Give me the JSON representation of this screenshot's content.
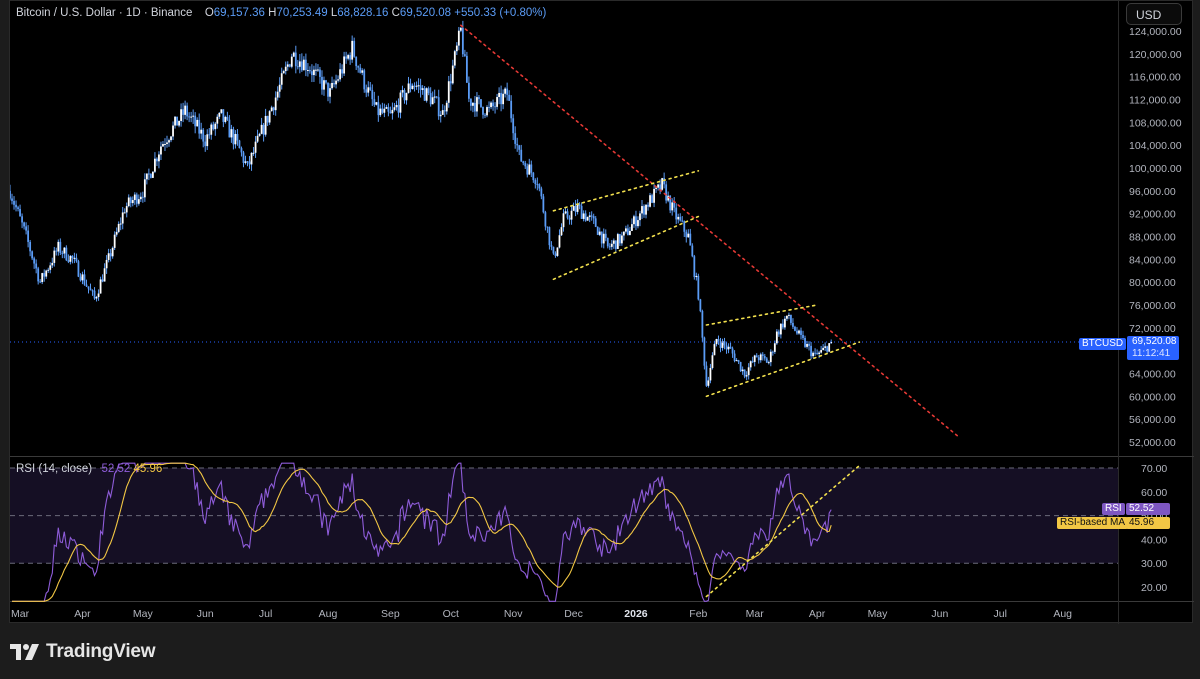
{
  "header": {
    "symbol": "Bitcoin / U.S. Dollar · 1D · Binance",
    "open_key": "O",
    "open": "69,157.36",
    "high_key": "H",
    "high": "70,253.49",
    "low_key": "L",
    "low": "68,828.16",
    "close_key": "C",
    "close": "69,520.08",
    "change": "+550.33 (+0.80%)"
  },
  "currency_button": "USD",
  "price_tag": {
    "symbol": "BTCUSD",
    "price": "69,520.08",
    "countdown": "11:12:41"
  },
  "rsi_legend": {
    "label": "RSI (14, close)",
    "rsi_value": "52.52",
    "ma_value": "45.96"
  },
  "rsi_tags": {
    "rsi_label": "RSI",
    "rsi_value": "52.52",
    "ma_label": "RSI-based MA",
    "ma_value": "45.96"
  },
  "branding": {
    "name": "TradingView"
  },
  "colors": {
    "candle": "#5b9cf6",
    "red_trend": "#e53935",
    "yellow": "#f2e04d",
    "rsi": "#8e5cd9",
    "rsi_ma": "#f2c744",
    "current_price": "#2962ff"
  },
  "chart_data": [
    {
      "type": "candlestick",
      "title": "Bitcoin / U.S. Dollar · 1D · Binance",
      "ylim": [
        50000,
        126000
      ],
      "y_ticks": [
        "124,000.00",
        "120,000.00",
        "116,000.00",
        "112,000.00",
        "108,000.00",
        "104,000.00",
        "100,000.00",
        "96,000.00",
        "92,000.00",
        "88,000.00",
        "84,000.00",
        "80,000.00",
        "76,000.00",
        "72,000.00",
        "68,000.00",
        "64,000.00",
        "60,000.00",
        "56,000.00",
        "52,000.00"
      ],
      "x_ticks": [
        "Mar",
        "Apr",
        "May",
        "Jun",
        "Jul",
        "Aug",
        "Sep",
        "Oct",
        "Nov",
        "Dec",
        "2026",
        "Feb",
        "Mar",
        "Apr",
        "May",
        "Jun",
        "Jul",
        "Aug"
      ],
      "x_range": [
        "2025-02-24",
        "2026-08-28"
      ],
      "current_price": 69520.08,
      "price_path": [
        [
          "2025-02-24",
          96000
        ],
        [
          "2025-03-04",
          88000
        ],
        [
          "2025-03-11",
          80000
        ],
        [
          "2025-03-20",
          86000
        ],
        [
          "2025-03-27",
          84000
        ],
        [
          "2025-04-07",
          77000
        ],
        [
          "2025-04-14",
          84000
        ],
        [
          "2025-04-22",
          93000
        ],
        [
          "2025-05-01",
          96000
        ],
        [
          "2025-05-10",
          104000
        ],
        [
          "2025-05-22",
          110000
        ],
        [
          "2025-06-01",
          105000
        ],
        [
          "2025-06-09",
          109000
        ],
        [
          "2025-06-17",
          104000
        ],
        [
          "2025-06-22",
          100000
        ],
        [
          "2025-07-01",
          108000
        ],
        [
          "2025-07-10",
          116000
        ],
        [
          "2025-07-14",
          120000
        ],
        [
          "2025-07-22",
          118000
        ],
        [
          "2025-08-02",
          113000
        ],
        [
          "2025-08-13",
          121000
        ],
        [
          "2025-08-19",
          115000
        ],
        [
          "2025-08-25",
          110000
        ],
        [
          "2025-09-01",
          109000
        ],
        [
          "2025-09-12",
          115000
        ],
        [
          "2025-09-22",
          112000
        ],
        [
          "2025-09-27",
          109500
        ],
        [
          "2025-10-06",
          124000
        ],
        [
          "2025-10-10",
          112000
        ],
        [
          "2025-10-20",
          110000
        ],
        [
          "2025-10-29",
          113000
        ],
        [
          "2025-11-04",
          102000
        ],
        [
          "2025-11-13",
          98000
        ],
        [
          "2025-11-21",
          84000
        ],
        [
          "2025-11-26",
          91000
        ],
        [
          "2025-12-03",
          93000
        ],
        [
          "2025-12-12",
          90000
        ],
        [
          "2025-12-18",
          86000
        ],
        [
          "2025-12-26",
          88000
        ],
        [
          "2026-01-05",
          93000
        ],
        [
          "2026-01-14",
          97000
        ],
        [
          "2026-01-20",
          92000
        ],
        [
          "2026-01-27",
          88000
        ],
        [
          "2026-02-01",
          78000
        ],
        [
          "2026-02-05",
          62000
        ],
        [
          "2026-02-10",
          70000
        ],
        [
          "2026-02-17",
          68000
        ],
        [
          "2026-02-24",
          64000
        ],
        [
          "2026-03-02",
          67000
        ],
        [
          "2026-03-08",
          66000
        ],
        [
          "2026-03-12",
          71000
        ],
        [
          "2026-03-17",
          74000
        ],
        [
          "2026-03-24",
          70000
        ],
        [
          "2026-03-31",
          67000
        ],
        [
          "2026-04-04",
          68000
        ],
        [
          "2026-04-08",
          69520
        ]
      ],
      "trendlines": [
        {
          "name": "descending resistance",
          "color": "#e53935",
          "points": [
            [
              "2025-10-06",
              125000
            ],
            [
              "2026-06-10",
              53000
            ]
          ]
        },
        {
          "name": "channel 1 upper",
          "color": "#f2e04d",
          "points": [
            [
              "2025-11-21",
              92500
            ],
            [
              "2026-02-01",
              99500
            ]
          ]
        },
        {
          "name": "channel 1 lower",
          "color": "#f2e04d",
          "points": [
            [
              "2025-11-21",
              80500
            ],
            [
              "2026-02-01",
              91500
            ]
          ]
        },
        {
          "name": "channel 2 upper",
          "color": "#f2e04d",
          "points": [
            [
              "2026-02-05",
              72500
            ],
            [
              "2026-04-01",
              76000
            ]
          ]
        },
        {
          "name": "channel 2 lower",
          "color": "#f2e04d",
          "points": [
            [
              "2026-02-05",
              60000
            ],
            [
              "2026-04-22",
              69500
            ]
          ]
        }
      ]
    },
    {
      "type": "line",
      "title": "RSI (14, close)",
      "ylim": [
        12,
        74
      ],
      "y_ticks": [
        "70.00",
        "60.00",
        "50.00",
        "40.00",
        "30.00",
        "20.00"
      ],
      "bands": [
        70,
        50,
        30
      ],
      "series": [
        {
          "name": "RSI",
          "color": "#8e5cd9"
        },
        {
          "name": "RSI-based MA",
          "color": "#f2c744"
        }
      ],
      "rsi_last": 52.52,
      "ma_last": 45.96,
      "rsi_trendline": {
        "color": "#f2e04d",
        "points": [
          [
            "2026-02-05",
            16
          ],
          [
            "2026-04-22",
            71
          ]
        ]
      }
    }
  ]
}
